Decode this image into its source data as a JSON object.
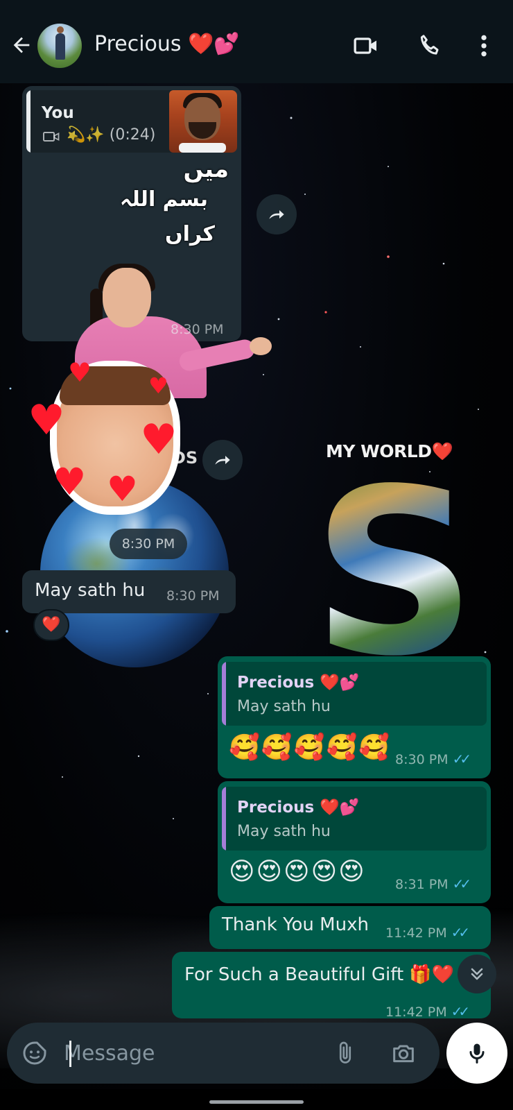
{
  "header": {
    "contact_name": "Precious ❤️💕"
  },
  "messages": {
    "m1": {
      "quote_author": "You",
      "quote_text": "💫✨ (0:24)",
      "sticker_text_1": "میں",
      "sticker_text_2": "بسم اللہ",
      "sticker_text_3": "کراں",
      "time": "8:30 PM"
    },
    "m2": {
      "time": "8:30 PM"
    },
    "m3": {
      "text": "May sath hu",
      "time": "8:30 PM",
      "reaction": "❤️"
    },
    "m4": {
      "quote_author": "Precious ❤️💕",
      "quote_text": "May sath hu",
      "emojis": "🥰🥰🥰🥰🥰",
      "time": "8:30 PM"
    },
    "m5": {
      "quote_author": "Precious ❤️💕",
      "quote_text": "May sath hu",
      "emojis": "😍😍😍😍😍",
      "time": "8:31 PM"
    },
    "m6": {
      "text": "Thank You Muxh",
      "time": "11:42 PM"
    },
    "m7": {
      "text": "For Such a Beautiful Gift 🎁❤️",
      "time": "11:42 PM"
    }
  },
  "wallpaper": {
    "title": "MY WORLD❤️",
    "letter": "S",
    "partial_text": "DS"
  },
  "composer": {
    "placeholder": "Message"
  },
  "colors": {
    "header_bg": "#0b141a",
    "incoming_bubble": "#1f2c34",
    "outgoing_bubble": "#005c4b",
    "read_ticks": "#53bdeb",
    "quote_bar_purple": "#a47ed8"
  },
  "icons": [
    "back-arrow-icon",
    "video-call-icon",
    "phone-icon",
    "more-vert-icon",
    "forward-icon",
    "sticker-icon",
    "attach-icon",
    "camera-icon",
    "mic-icon",
    "double-chevron-down-icon"
  ]
}
